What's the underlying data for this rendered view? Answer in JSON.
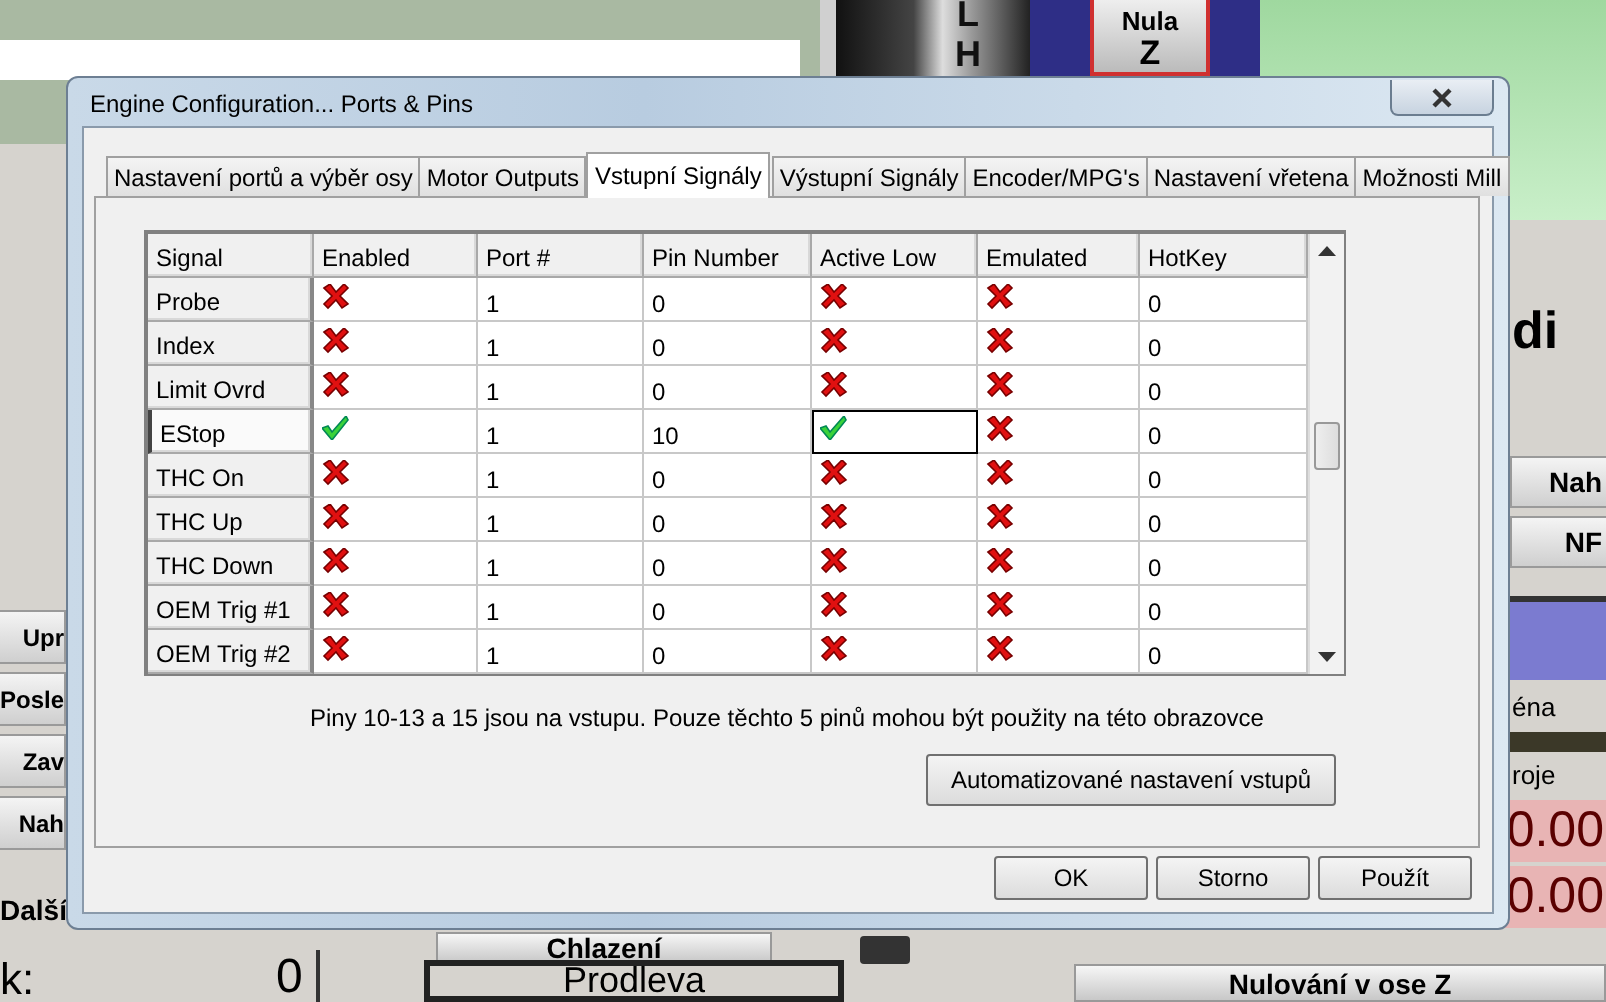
{
  "background": {
    "axis_letters": [
      "L",
      "H"
    ],
    "zero_button": {
      "label": "Nula",
      "axis": "Z"
    },
    "left_buttons": [
      "Upr",
      "Posle",
      "Zav",
      "Nah"
    ],
    "next_button": "Další",
    "field_label": "k:",
    "field_value": "0",
    "right_heading": "di",
    "right_buttons": [
      "Nah",
      "NF"
    ],
    "right_labels": [
      "éna",
      "roje"
    ],
    "readouts": [
      "0.00",
      "0.00"
    ],
    "bottom_buttons": [
      {
        "label": "Chlazení",
        "kind": "button"
      },
      {
        "label": "Prodleva",
        "kind": "framed"
      },
      {
        "label": "Nulování v ose Z",
        "kind": "button"
      }
    ]
  },
  "window": {
    "title": "Engine Configuration... Ports & Pins"
  },
  "tabs": [
    {
      "label": "Nastavení portů a výběr osy",
      "selected": false
    },
    {
      "label": "Motor Outputs",
      "selected": false
    },
    {
      "label": "Vstupní Signály",
      "selected": true
    },
    {
      "label": "Výstupní Signály",
      "selected": false
    },
    {
      "label": "Encoder/MPG's",
      "selected": false
    },
    {
      "label": "Nastavení vřetena",
      "selected": false
    },
    {
      "label": "Možnosti Mill",
      "selected": false
    }
  ],
  "table": {
    "columns": [
      "Signal",
      "Enabled",
      "Port #",
      "Pin Number",
      "Active Low",
      "Emulated",
      "HotKey"
    ],
    "rows": [
      {
        "signal": "Probe",
        "enabled": false,
        "port": "1",
        "pin": "0",
        "active_low": false,
        "emulated": false,
        "hotkey": "0",
        "selected": false
      },
      {
        "signal": "Index",
        "enabled": false,
        "port": "1",
        "pin": "0",
        "active_low": false,
        "emulated": false,
        "hotkey": "0",
        "selected": false
      },
      {
        "signal": "Limit Ovrd",
        "enabled": false,
        "port": "1",
        "pin": "0",
        "active_low": false,
        "emulated": false,
        "hotkey": "0",
        "selected": false
      },
      {
        "signal": "EStop",
        "enabled": true,
        "port": "1",
        "pin": "10",
        "active_low": true,
        "emulated": false,
        "hotkey": "0",
        "selected": true
      },
      {
        "signal": "THC On",
        "enabled": false,
        "port": "1",
        "pin": "0",
        "active_low": false,
        "emulated": false,
        "hotkey": "0",
        "selected": false
      },
      {
        "signal": "THC Up",
        "enabled": false,
        "port": "1",
        "pin": "0",
        "active_low": false,
        "emulated": false,
        "hotkey": "0",
        "selected": false
      },
      {
        "signal": "THC Down",
        "enabled": false,
        "port": "1",
        "pin": "0",
        "active_low": false,
        "emulated": false,
        "hotkey": "0",
        "selected": false
      },
      {
        "signal": "OEM Trig #1",
        "enabled": false,
        "port": "1",
        "pin": "0",
        "active_low": false,
        "emulated": false,
        "hotkey": "0",
        "selected": false
      },
      {
        "signal": "OEM Trig #2",
        "enabled": false,
        "port": "1",
        "pin": "0",
        "active_low": false,
        "emulated": false,
        "hotkey": "0",
        "selected": false
      }
    ]
  },
  "note": "Piny 10-13 a 15 jsou na vstupu. Pouze těchto 5 pinů mohou být použity na této obrazovce",
  "auto_button": "Automatizované nastavení vstupů",
  "buttons": [
    "OK",
    "Storno",
    "Použít"
  ]
}
